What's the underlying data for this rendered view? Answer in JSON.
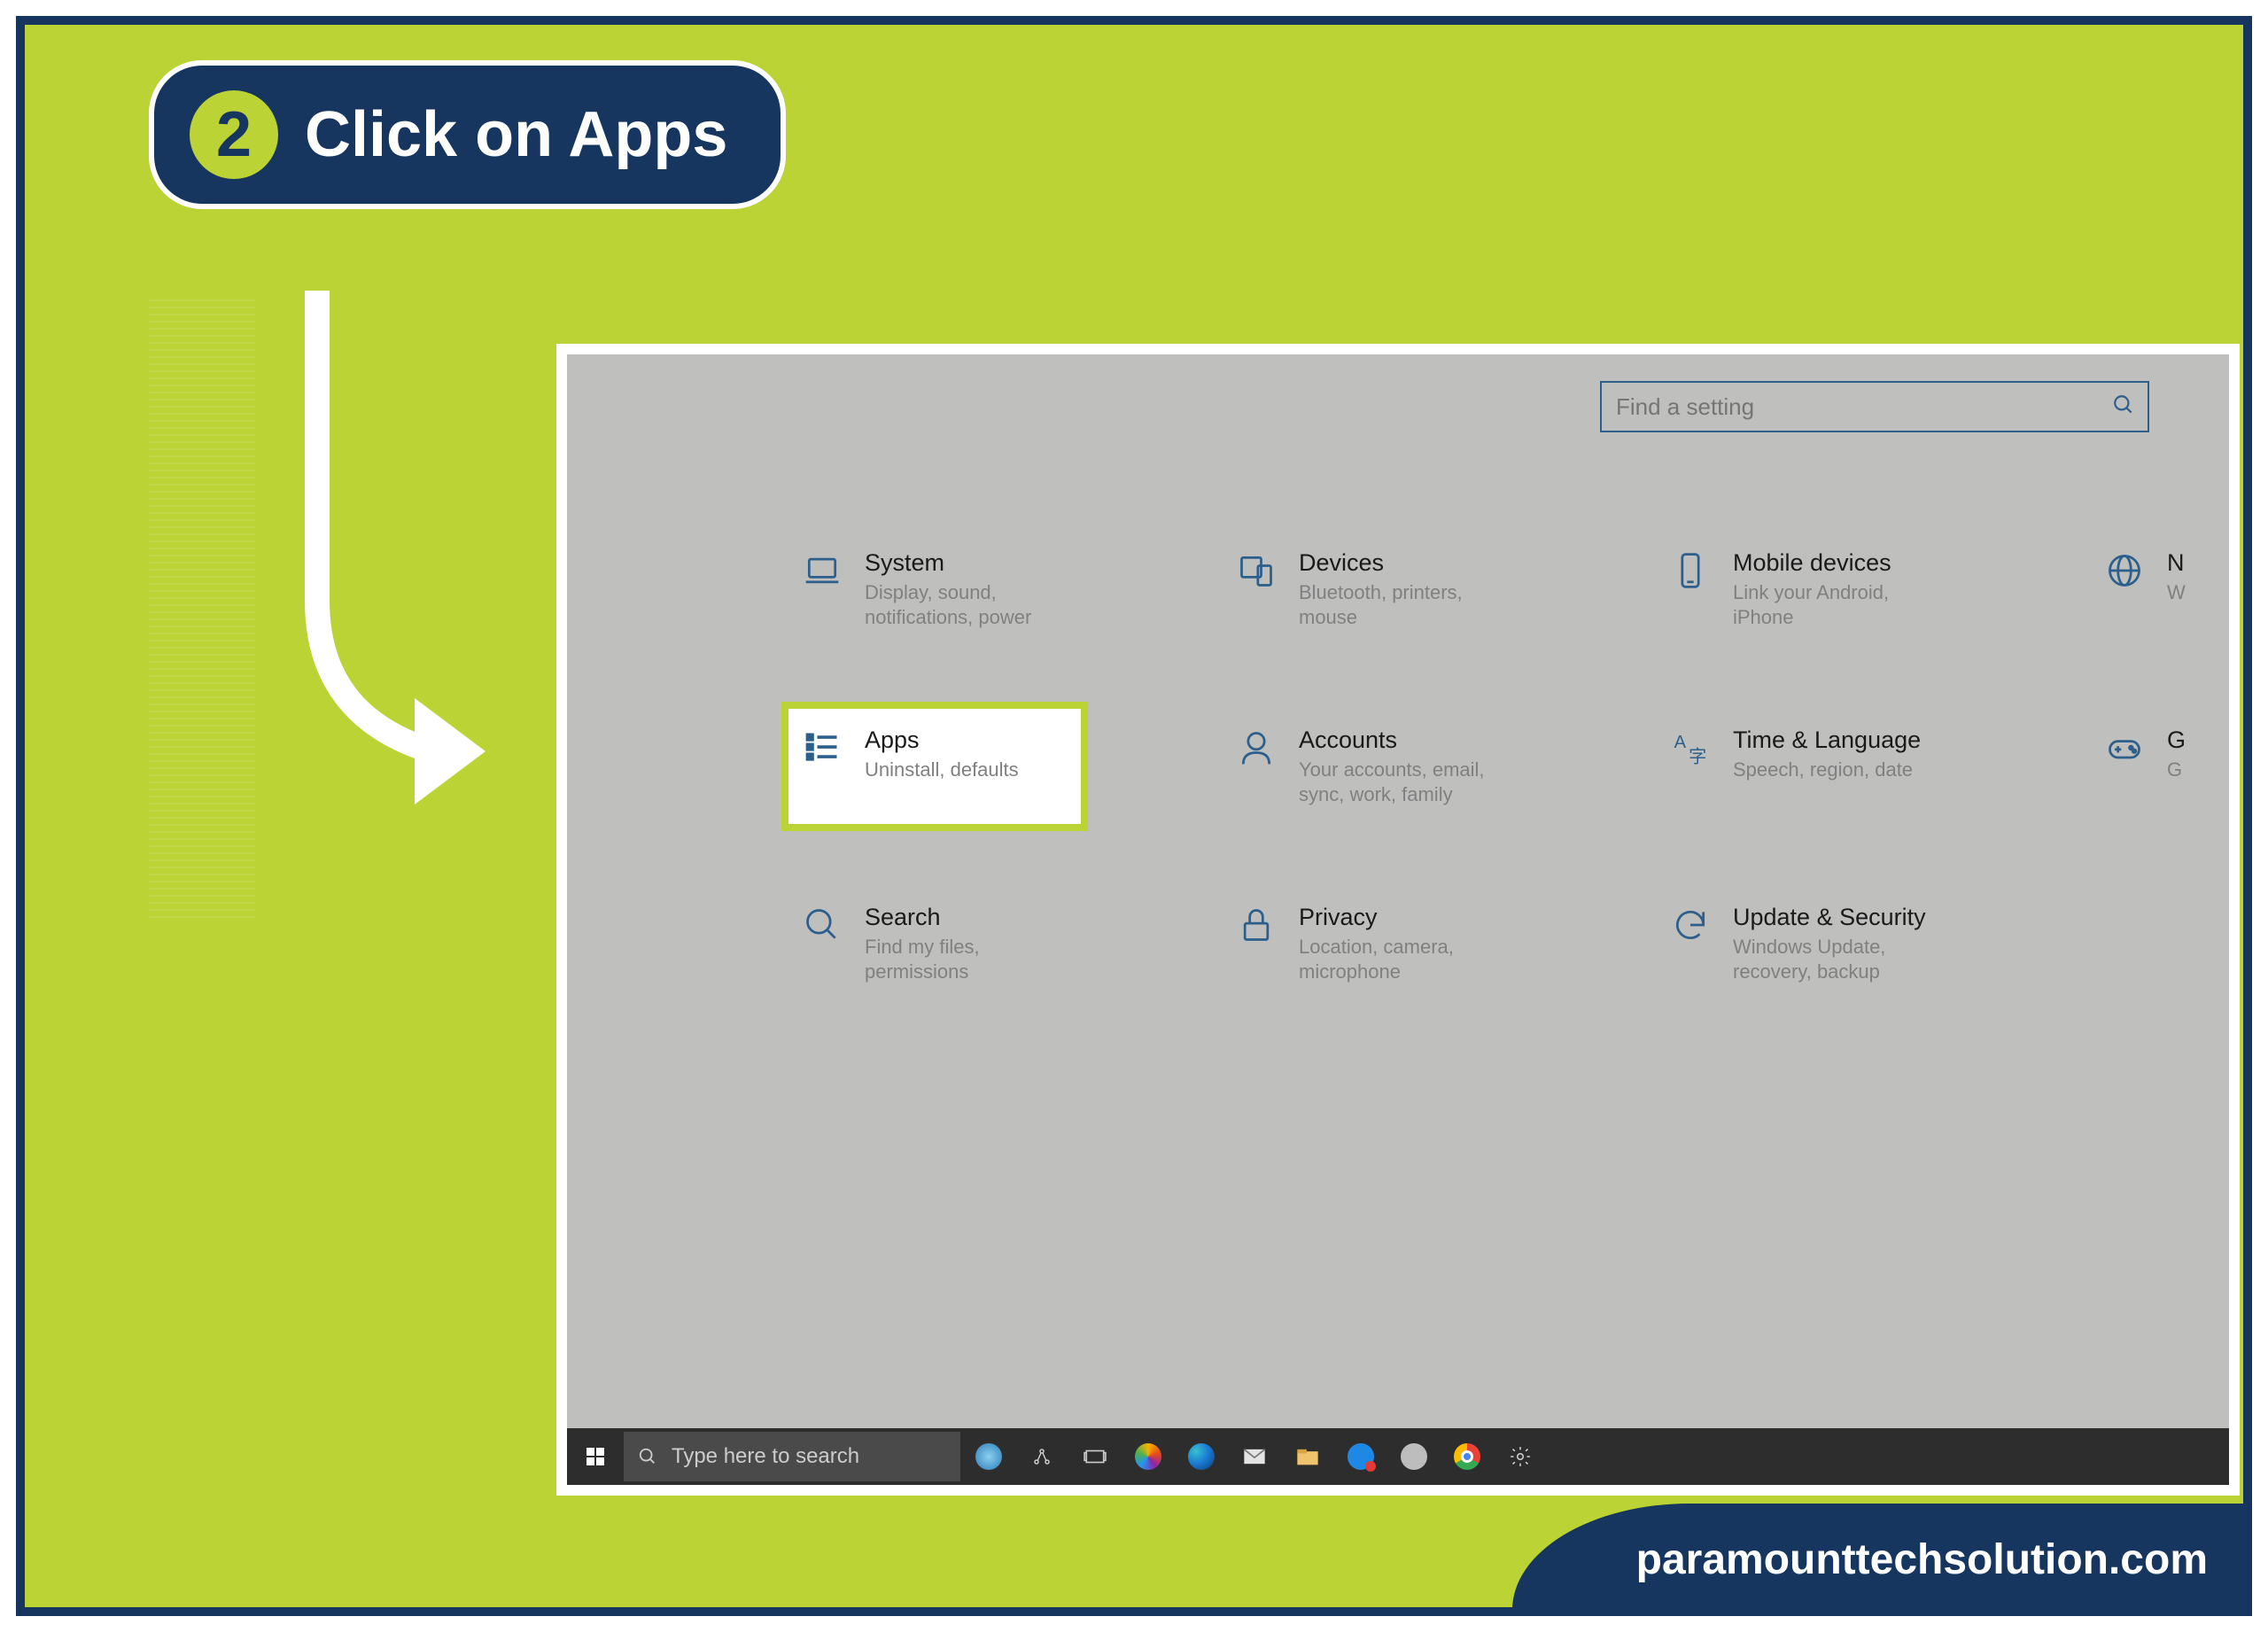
{
  "step": {
    "number": "2",
    "label": "Click on Apps"
  },
  "search": {
    "placeholder": "Find a setting"
  },
  "tiles": {
    "system": {
      "title": "System",
      "desc": "Display, sound, notifications, power"
    },
    "devices": {
      "title": "Devices",
      "desc": "Bluetooth, printers, mouse"
    },
    "mobile": {
      "title": "Mobile devices",
      "desc": "Link your Android, iPhone"
    },
    "network": {
      "title": "N",
      "desc": "W"
    },
    "apps": {
      "title": "Apps",
      "desc": "Uninstall, defaults"
    },
    "accounts": {
      "title": "Accounts",
      "desc": "Your accounts, email, sync, work, family"
    },
    "time": {
      "title": "Time & Language",
      "desc": "Speech, region, date"
    },
    "gaming": {
      "title": "G",
      "desc": "G"
    },
    "search": {
      "title": "Search",
      "desc": "Find my files, permissions"
    },
    "privacy": {
      "title": "Privacy",
      "desc": "Location, camera, microphone"
    },
    "update": {
      "title": "Update & Security",
      "desc": "Windows Update, recovery, backup"
    }
  },
  "taskbar": {
    "search_placeholder": "Type here to search"
  },
  "footer": {
    "site": "paramounttechsolution.com"
  }
}
